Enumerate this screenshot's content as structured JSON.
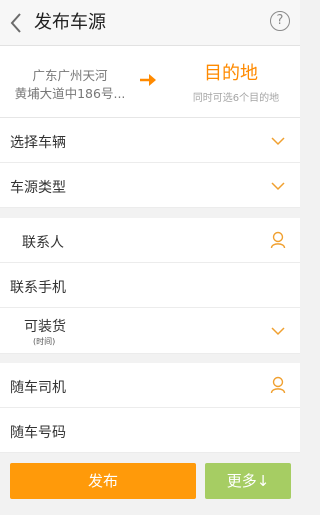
{
  "header": {
    "title": "发布车源",
    "help_symbol": "?"
  },
  "route": {
    "origin_line1": "广东广州天河",
    "origin_line2": "黄埔大道中186号...",
    "destination_title": "目的地",
    "destination_hint": "同时可选6个目的地"
  },
  "form": {
    "select_vehicle_label": "选择车辆",
    "source_type_label": "车源类型",
    "contact_label": "联系人",
    "contact_phone_label": "联系手机",
    "loadable_label": "可装货",
    "loadable_sublabel": "(时间)",
    "driver_label": "随车司机",
    "driver_phone_label": "随车号码"
  },
  "actions": {
    "publish_label": "发布",
    "more_label": "更多↓"
  },
  "colors": {
    "accent": "#ff8a00",
    "publish": "#ff9a0a",
    "more": "#a6cd63"
  },
  "icons": [
    "back-arrow-icon",
    "help-icon",
    "right-arrow-icon",
    "chevron-down-icon",
    "person-icon"
  ]
}
